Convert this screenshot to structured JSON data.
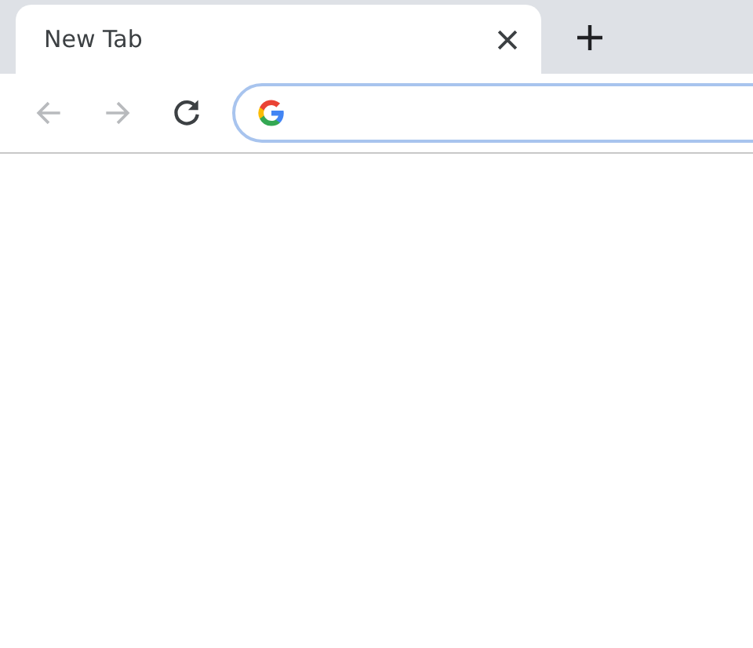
{
  "tabs": [
    {
      "title": "New Tab",
      "selected": true
    }
  ],
  "toolbar": {
    "back": {
      "disabled": true
    },
    "forward": {
      "disabled": true
    },
    "address_bar": {
      "focused": true
    }
  }
}
